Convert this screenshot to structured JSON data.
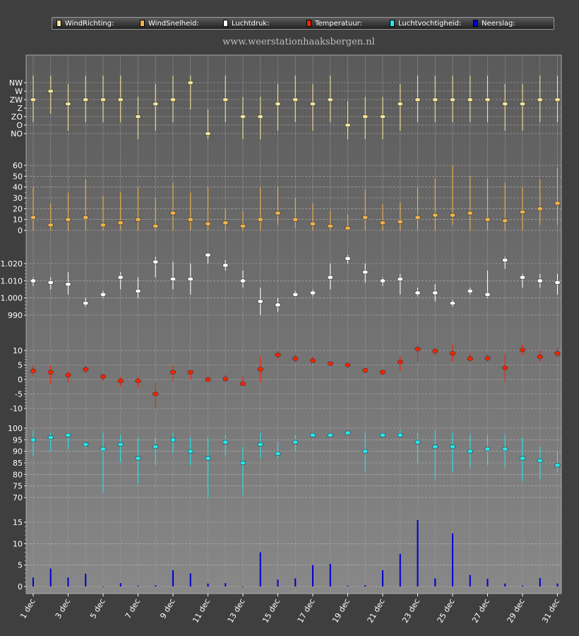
{
  "site_url": "www.weerstationhaaksbergen.nl",
  "legend": [
    {
      "label": "WindRichting:",
      "color": "#f3e49b"
    },
    {
      "label": "WindSnelheid:",
      "color": "#f2b24c"
    },
    {
      "label": "Luchtdruk:",
      "color": "#ffffff"
    },
    {
      "label": "Temperatuur:",
      "color": "#ff2200"
    },
    {
      "label": "Luchtvochtigheid:",
      "color": "#22e8f0"
    },
    {
      "label": "Neerslag:",
      "color": "#0000cc"
    }
  ],
  "chart_data": {
    "type": "scatter",
    "x_labels": [
      "1 dec",
      "3 dec",
      "5 dec",
      "7 dec",
      "9 dec",
      "11 dec",
      "13 dec",
      "15 dec",
      "17 dec",
      "19 dec",
      "21 dec",
      "23 dec",
      "25 dec",
      "27 dec",
      "29 dec",
      "31 dec"
    ],
    "days": [
      1,
      2,
      3,
      4,
      5,
      6,
      7,
      8,
      9,
      10,
      11,
      12,
      13,
      14,
      15,
      16,
      17,
      18,
      19,
      20,
      21,
      22,
      23,
      24,
      25,
      26,
      27,
      28,
      29,
      30,
      31
    ],
    "panels": [
      {
        "name": "WindRichting",
        "color": "#f3e49b",
        "type": "range",
        "y_scale": "compass",
        "ticks": [
          "NO",
          "O",
          "ZO",
          "Z",
          "ZW",
          "W",
          "NW"
        ],
        "values": [
          "ZW",
          "W",
          "ZZW",
          "ZW",
          "ZW",
          "ZW",
          "ZO",
          "ZZW",
          "ZW",
          "NW",
          "NO",
          "ZW",
          "ZO",
          "ZO",
          "ZZW",
          "ZW",
          "ZZW",
          "ZW",
          "O",
          "ZO",
          "ZO",
          "ZZW",
          "ZW",
          "ZW",
          "ZW",
          "ZW",
          "ZW",
          "ZZW",
          "ZZW",
          "ZW",
          "ZW"
        ]
      },
      {
        "name": "WindSnelheid",
        "color": "#f2b24c",
        "type": "range",
        "ticks": [
          0,
          10,
          20,
          30,
          40,
          50,
          60
        ],
        "values": [
          12,
          5,
          10,
          12,
          5,
          7,
          10,
          4,
          16,
          10,
          6,
          7,
          4,
          10,
          16,
          10,
          6,
          4,
          2,
          12,
          7,
          8,
          12,
          14,
          14,
          16,
          10,
          9,
          17,
          20,
          25
        ],
        "lows": [
          0,
          0,
          0,
          0,
          0,
          0,
          0,
          0,
          0,
          0,
          0,
          0,
          0,
          0,
          5,
          2,
          0,
          0,
          0,
          0,
          0,
          0,
          0,
          0,
          5,
          0,
          0,
          0,
          0,
          5,
          5
        ],
        "highs": [
          40,
          25,
          35,
          47,
          32,
          35,
          40,
          30,
          44,
          35,
          40,
          20,
          18,
          40,
          40,
          30,
          25,
          18,
          15,
          38,
          24,
          26,
          40,
          48,
          60,
          50,
          48,
          44,
          40,
          47,
          58
        ]
      },
      {
        "name": "Luchtdruk",
        "color": "#ffffff",
        "type": "range",
        "ticks": [
          990,
          1000,
          1010,
          1020
        ],
        "tick_labels": [
          "990",
          "1.000",
          "1.010",
          "1.020"
        ],
        "values": [
          1010,
          1009,
          1008,
          997,
          1002,
          1012,
          1004,
          1021,
          1011,
          1011,
          1025,
          1019,
          1010,
          998,
          996,
          1002,
          1003,
          1012,
          1023,
          1015,
          1010,
          1011,
          1003,
          1003,
          997,
          1004,
          1002,
          1022,
          1012,
          1010,
          1009
        ],
        "lows": [
          1007,
          1005,
          1002,
          995,
          1000,
          1005,
          1000,
          1012,
          1005,
          1002,
          1020,
          1016,
          1006,
          990,
          992,
          1001,
          1001,
          1005,
          1020,
          1009,
          1007,
          1002,
          1001,
          998,
          995,
          1002,
          1000,
          1017,
          1006,
          1006,
          1002
        ],
        "highs": [
          1012,
          1012,
          1015,
          1000,
          1004,
          1015,
          1012,
          1024,
          1021,
          1020,
          1026,
          1022,
          1016,
          1006,
          1000,
          1004,
          1005,
          1020,
          1025,
          1020,
          1012,
          1014,
          1006,
          1008,
          999,
          1006,
          1016,
          1024,
          1014,
          1014,
          1014
        ]
      },
      {
        "name": "Temperatuur",
        "color": "#ff2200",
        "type": "range",
        "ticks": [
          -10,
          -5,
          0,
          5,
          10
        ],
        "values": [
          3,
          2.5,
          1.5,
          3.5,
          1,
          -0.5,
          -0.5,
          -5,
          2.5,
          2.5,
          0,
          0.2,
          -1.5,
          3.5,
          8.5,
          7.2,
          6.5,
          5.5,
          5,
          3.2,
          2.5,
          6,
          10.5,
          9.8,
          9,
          7.2,
          7.3,
          4,
          10.2,
          7.8,
          9
        ],
        "lows": [
          1,
          -1.5,
          -1,
          2,
          -0.5,
          -2.5,
          -3,
          -10,
          -0.5,
          0,
          -1,
          -1,
          -2,
          -1,
          7,
          6,
          6,
          5,
          4,
          2,
          1.5,
          3,
          6,
          8,
          6,
          6,
          6,
          -1,
          8.5,
          6,
          7.5
        ],
        "highs": [
          5,
          5,
          3,
          5,
          2,
          1,
          1,
          -1,
          5,
          3,
          1,
          2,
          1,
          8,
          10,
          9,
          8,
          6,
          6,
          4,
          3.5,
          8,
          12,
          11,
          12,
          9,
          9,
          9,
          12,
          10,
          11
        ]
      },
      {
        "name": "Luchtvochtigheid",
        "color": "#22e8f0",
        "type": "range",
        "ticks": [
          70,
          75,
          80,
          85,
          90,
          95,
          100
        ],
        "values": [
          95,
          96,
          97,
          93,
          91,
          93,
          87,
          92,
          95,
          90,
          87,
          94,
          85,
          93,
          89,
          94,
          97,
          97,
          98,
          90,
          97,
          97,
          94,
          92,
          92,
          90,
          91,
          91,
          87,
          86,
          84
        ],
        "lows": [
          88,
          90,
          91,
          91,
          72,
          85,
          76,
          84,
          89,
          84,
          70,
          88,
          71,
          87,
          87,
          90,
          96,
          96,
          97,
          81,
          96,
          96,
          85,
          78,
          81,
          83,
          84,
          83,
          77,
          78,
          81
        ],
        "highs": [
          99,
          98,
          98,
          94,
          98,
          97,
          96,
          96,
          98,
          96,
          96,
          97,
          92,
          98,
          94,
          97,
          98,
          98,
          99,
          98,
          98,
          99,
          98,
          99,
          98,
          97,
          97,
          97,
          96,
          92,
          90
        ]
      },
      {
        "name": "Neerslag",
        "color": "#0000cc",
        "type": "bar",
        "ticks": [
          0,
          5,
          10,
          15
        ],
        "values": [
          2.1,
          4.2,
          2.1,
          3,
          0,
          0.8,
          0.2,
          0.3,
          3.8,
          3.1,
          0.7,
          0.8,
          0,
          8,
          1.6,
          1.9,
          5,
          5.3,
          0.2,
          0.3,
          3.8,
          7.6,
          15.5,
          1.9,
          12.4,
          2.7,
          1.8,
          0.7,
          0.2,
          2,
          0.7
        ]
      }
    ]
  }
}
